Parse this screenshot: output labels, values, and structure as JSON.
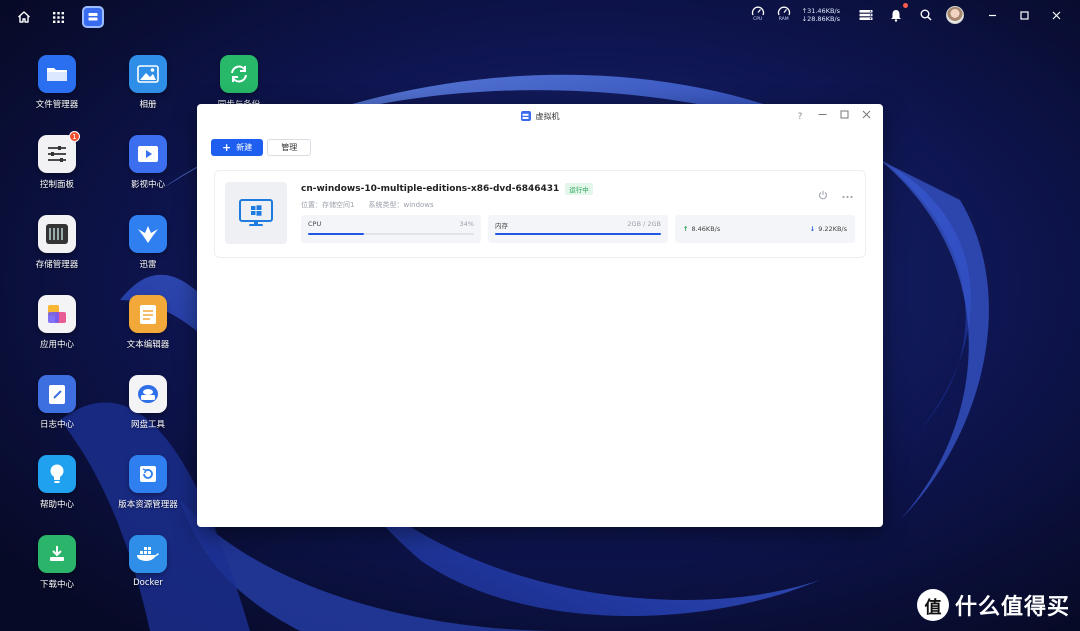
{
  "topbar": {
    "gauges": [
      {
        "icon": "cpu-gauge-icon",
        "label": "CPU"
      },
      {
        "icon": "ram-gauge-icon",
        "label": "RAM"
      }
    ],
    "upload_speed": "↑31.46KB/s",
    "download_speed": "↓28.86KB/s"
  },
  "desktop": {
    "icons": [
      {
        "id": "file-manager",
        "label": "文件管理器",
        "color": "#2a6ff0",
        "icon": "folder-icon"
      },
      {
        "id": "album",
        "label": "相册",
        "color": "#2f8ee8",
        "icon": "image-icon"
      },
      {
        "id": "sync-backup",
        "label": "同步与备份",
        "color": "#27b869",
        "icon": "sync-icon"
      },
      {
        "id": "control-panel",
        "label": "控制面板",
        "color": "#f2f2f4",
        "icon": "sliders-icon",
        "badge": "1"
      },
      {
        "id": "video-center",
        "label": "影视中心",
        "color": "#3b6ff0",
        "icon": "video-icon"
      },
      {
        "id": "storage-manager",
        "label": "存储管理器",
        "color": "#f2f2f4",
        "icon": "storage-icon"
      },
      {
        "id": "xunlei",
        "label": "迅雷",
        "color": "#2f7ff0",
        "icon": "xunlei-bird-icon"
      },
      {
        "id": "app-center",
        "label": "应用中心",
        "color": "#f4f4f6",
        "icon": "app-center-icon"
      },
      {
        "id": "text-editor",
        "label": "文本编辑器",
        "color": "#f3a93a",
        "icon": "notepad-icon"
      },
      {
        "id": "log-center",
        "label": "日志中心",
        "color": "#3d6fe0",
        "icon": "log-icon"
      },
      {
        "id": "disk-tool",
        "label": "网盘工具",
        "color": "#f4f4f6",
        "icon": "cloud-disk-icon"
      },
      {
        "id": "help-center",
        "label": "帮助中心",
        "color": "#1fa1f0",
        "icon": "lightbulb-icon"
      },
      {
        "id": "version-manager",
        "label": "版本资源管理器",
        "color": "#2f7ff0",
        "icon": "version-history-icon"
      },
      {
        "id": "download-center",
        "label": "下载中心",
        "color": "#2bb56a",
        "icon": "download-icon"
      },
      {
        "id": "docker",
        "label": "Docker",
        "color": "#2f8fe8",
        "icon": "docker-whale-icon"
      }
    ]
  },
  "window": {
    "title": "虚拟机",
    "help": "?",
    "toolbar": {
      "new_label": "新建",
      "manage_label": "管理"
    },
    "vm": {
      "name": "cn-windows-10-multiple-editions-x86-dvd-6846431",
      "status": "运行中",
      "location": "位置：存储空间1",
      "os_type": "系统类型：windows",
      "cpu": {
        "label": "CPU",
        "value": "34%",
        "fraction": 0.34
      },
      "memory": {
        "label": "内存",
        "value": "2GB / 2GB",
        "fraction": 1.0
      },
      "net_up": "8.46KB/s",
      "net_down": "9.22KB/s"
    }
  },
  "watermark": {
    "logo_char": "值",
    "text": "什么值得买"
  }
}
